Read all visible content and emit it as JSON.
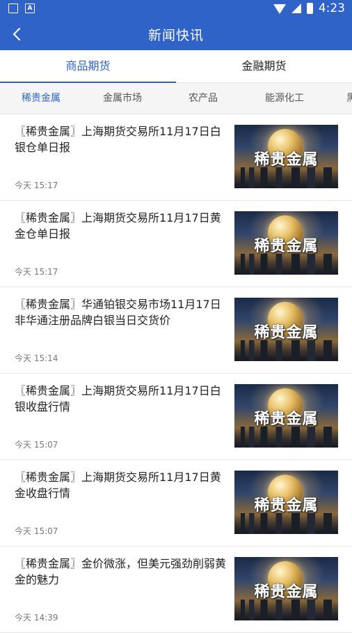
{
  "statusbar": {
    "time": "4:23",
    "icons": [
      "gallery-icon",
      "a-icon",
      "wifi-icon",
      "signal-icon",
      "battery-icon"
    ]
  },
  "header": {
    "title": "新闻快讯",
    "back_icon": "chevron-left-icon"
  },
  "tabs": [
    {
      "label": "商品期货",
      "active": true
    },
    {
      "label": "金融期货",
      "active": false
    }
  ],
  "categories": [
    {
      "label": "稀贵金属",
      "active": true
    },
    {
      "label": "金属市场",
      "active": false
    },
    {
      "label": "农产品",
      "active": false
    },
    {
      "label": "能源化工",
      "active": false
    },
    {
      "label": "黑",
      "active": false
    }
  ],
  "news": [
    {
      "headline": "〖稀贵金属〗上海期货交易所11月17日白银仓单日报",
      "time": "今天 15:17",
      "thumb_text": "稀贵金属"
    },
    {
      "headline": "〖稀贵金属〗上海期货交易所11月17日黄金仓单日报",
      "time": "今天 15:17",
      "thumb_text": "稀贵金属"
    },
    {
      "headline": "〖稀贵金属〗华通铂银交易市场11月17日非华通注册品牌白银当日交货价",
      "time": "今天 15:14",
      "thumb_text": "稀贵金属"
    },
    {
      "headline": "〖稀贵金属〗上海期货交易所11月17日白银收盘行情",
      "time": "今天 15:07",
      "thumb_text": "稀贵金属"
    },
    {
      "headline": "〖稀贵金属〗上海期货交易所11月17日黄金收盘行情",
      "time": "今天 15:07",
      "thumb_text": "稀贵金属"
    },
    {
      "headline": "〖稀贵金属〗金价微涨，但美元强劲削弱黄金的魅力",
      "time": "今天 14:39",
      "thumb_text": "稀贵金属"
    }
  ],
  "colors": {
    "primary": "#2f63c8",
    "background": "#ffffff",
    "category_bar": "#f5f5f5"
  }
}
